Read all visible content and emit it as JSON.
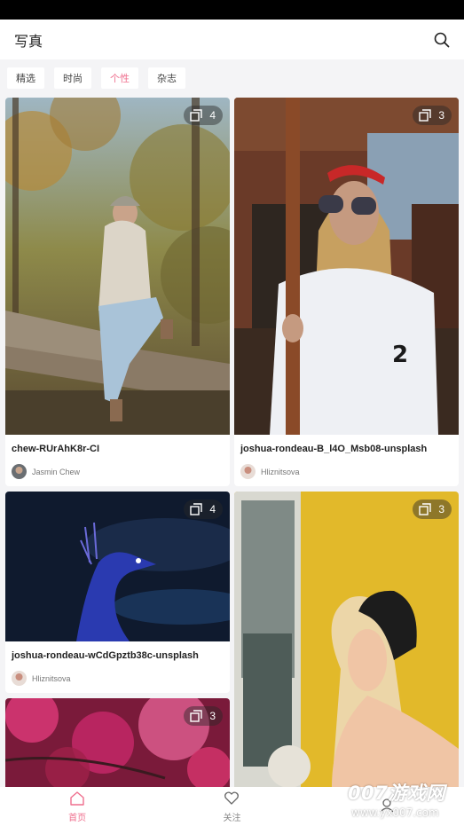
{
  "header": {
    "title": "写真"
  },
  "tabs": [
    {
      "label": "精选",
      "active": false
    },
    {
      "label": "时尚",
      "active": false
    },
    {
      "label": "个性",
      "active": true
    },
    {
      "label": "杂志",
      "active": false
    }
  ],
  "cards": [
    {
      "count": "4",
      "caption": "chew-RUrAhK8r-CI",
      "author": "Jasmin Chew"
    },
    {
      "count": "3",
      "caption": "joshua-rondeau-B_l4O_Msb08-unsplash",
      "author": "Hliznitsova"
    },
    {
      "count": "4",
      "caption": "joshua-rondeau-wCdGpztb38c-unsplash",
      "author": "Hliznitsova"
    },
    {
      "count": "3"
    },
    {
      "count": "3"
    }
  ],
  "nav": [
    {
      "label": "首页",
      "active": true
    },
    {
      "label": "关注",
      "active": false
    }
  ],
  "watermark": {
    "line1": "007游戏网",
    "line2": "www.yx007.com"
  },
  "colors": {
    "accent": "#ef6f8e",
    "background": "#f4f4f6"
  }
}
